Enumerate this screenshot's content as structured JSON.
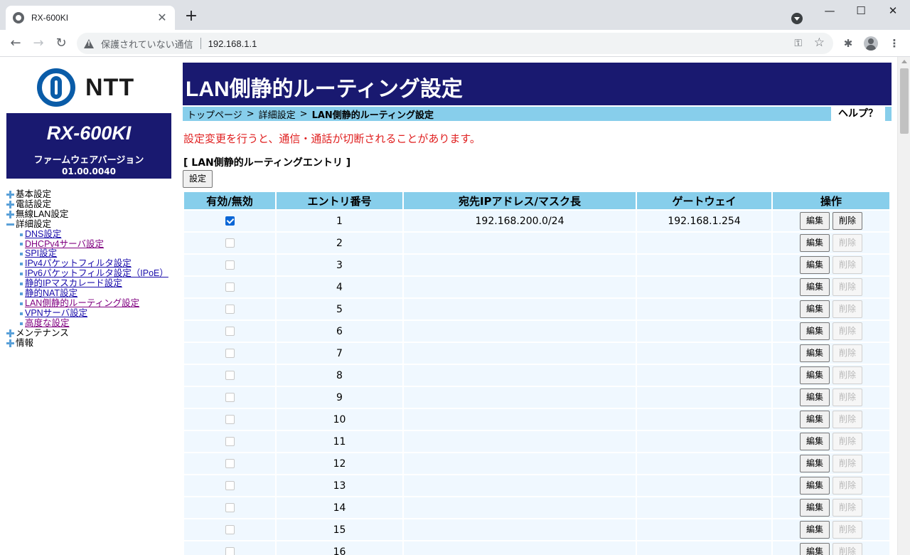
{
  "browser": {
    "tab_title": "RX-600KI",
    "tab_close": "✕",
    "new_tab": "+",
    "security_label": "保護されていない通信",
    "url": "192.168.1.1",
    "window_controls": {
      "minimize": "—",
      "maximize": "☐",
      "close": "✕"
    }
  },
  "sidebar": {
    "logo_text": "NTT",
    "model": "RX-600KI",
    "firmware_label": "ファームウェアバージョン",
    "firmware_version": "01.00.0040",
    "menu": [
      {
        "label": "基本設定",
        "expanded": false
      },
      {
        "label": "電話設定",
        "expanded": false
      },
      {
        "label": "無線LAN設定",
        "expanded": false
      },
      {
        "label": "詳細設定",
        "expanded": true,
        "children": [
          {
            "label": "DNS設定",
            "visited": false
          },
          {
            "label": "DHCPv4サーバ設定",
            "visited": true
          },
          {
            "label": "SPI設定",
            "visited": false
          },
          {
            "label": "IPv4パケットフィルタ設定",
            "visited": false
          },
          {
            "label": "IPv6パケットフィルタ設定（IPoE）",
            "visited": false
          },
          {
            "label": "静的IPマスカレード設定",
            "visited": false
          },
          {
            "label": "静的NAT設定",
            "visited": false
          },
          {
            "label": "LAN側静的ルーティング設定",
            "visited": true
          },
          {
            "label": "VPNサーバ設定",
            "visited": false
          },
          {
            "label": "高度な設定",
            "visited": true
          }
        ]
      },
      {
        "label": "メンテナンス",
        "expanded": false
      },
      {
        "label": "情報",
        "expanded": false
      }
    ]
  },
  "main": {
    "title": "LAN側静的ルーティング設定",
    "breadcrumb": {
      "home": "トップページ",
      "sep": ">",
      "parent": "詳細設定",
      "current": "LAN側静的ルーティング設定"
    },
    "help": "ヘルプ？",
    "warning": "設定変更を行うと、通信・通話が切断されることがあります。",
    "section_title": "[ LAN側静的ルーティングエントリ ]",
    "set_button": "設定",
    "table": {
      "headers": [
        "有効/無効",
        "エントリ番号",
        "宛先IPアドレス/マスク長",
        "ゲートウェイ",
        "操作"
      ],
      "edit_label": "編集",
      "delete_label": "削除",
      "rows": [
        {
          "enabled": true,
          "entry": "1",
          "dest": "192.168.200.0/24",
          "gateway": "192.168.1.254",
          "deletable": true
        },
        {
          "enabled": false,
          "entry": "2",
          "dest": "",
          "gateway": "",
          "deletable": false
        },
        {
          "enabled": false,
          "entry": "3",
          "dest": "",
          "gateway": "",
          "deletable": false
        },
        {
          "enabled": false,
          "entry": "4",
          "dest": "",
          "gateway": "",
          "deletable": false
        },
        {
          "enabled": false,
          "entry": "5",
          "dest": "",
          "gateway": "",
          "deletable": false
        },
        {
          "enabled": false,
          "entry": "6",
          "dest": "",
          "gateway": "",
          "deletable": false
        },
        {
          "enabled": false,
          "entry": "7",
          "dest": "",
          "gateway": "",
          "deletable": false
        },
        {
          "enabled": false,
          "entry": "8",
          "dest": "",
          "gateway": "",
          "deletable": false
        },
        {
          "enabled": false,
          "entry": "9",
          "dest": "",
          "gateway": "",
          "deletable": false
        },
        {
          "enabled": false,
          "entry": "10",
          "dest": "",
          "gateway": "",
          "deletable": false
        },
        {
          "enabled": false,
          "entry": "11",
          "dest": "",
          "gateway": "",
          "deletable": false
        },
        {
          "enabled": false,
          "entry": "12",
          "dest": "",
          "gateway": "",
          "deletable": false
        },
        {
          "enabled": false,
          "entry": "13",
          "dest": "",
          "gateway": "",
          "deletable": false
        },
        {
          "enabled": false,
          "entry": "14",
          "dest": "",
          "gateway": "",
          "deletable": false
        },
        {
          "enabled": false,
          "entry": "15",
          "dest": "",
          "gateway": "",
          "deletable": false
        },
        {
          "enabled": false,
          "entry": "16",
          "dest": "",
          "gateway": "",
          "deletable": false
        }
      ]
    }
  },
  "colors": {
    "header_navy": "#191970",
    "crumb_blue": "#87ceeb",
    "row_bg": "#f0f8ff",
    "warning_red": "#e02020"
  }
}
